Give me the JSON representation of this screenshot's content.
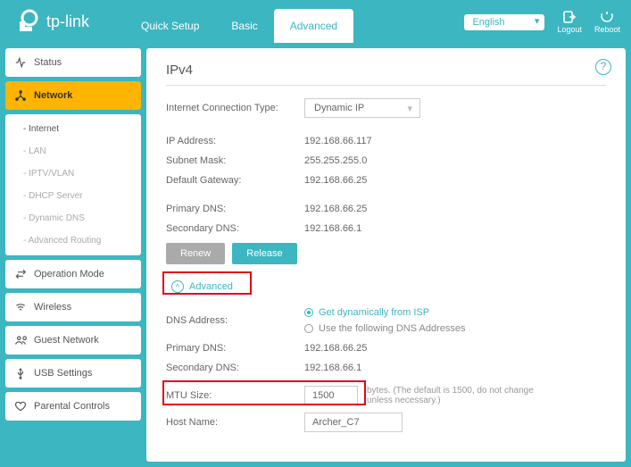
{
  "brand": "tp-link",
  "tabs": {
    "quick": "Quick Setup",
    "basic": "Basic",
    "advanced": "Advanced"
  },
  "language": "English",
  "top_actions": {
    "logout": "Logout",
    "reboot": "Reboot"
  },
  "sidebar": {
    "status": "Status",
    "network": "Network",
    "network_sub": {
      "internet": "Internet",
      "lan": "LAN",
      "iptv": "IPTV/VLAN",
      "dhcp": "DHCP Server",
      "ddns": "Dynamic DNS",
      "routing": "Advanced Routing"
    },
    "opmode": "Operation Mode",
    "wireless": "Wireless",
    "guest": "Guest Network",
    "usb": "USB Settings",
    "parental": "Parental Controls"
  },
  "page": {
    "title": "IPv4",
    "conn_type_label": "Internet Connection Type:",
    "conn_type_value": "Dynamic IP",
    "ip_label": "IP Address:",
    "ip_value": "192.168.66.117",
    "mask_label": "Subnet Mask:",
    "mask_value": "255.255.255.0",
    "gw_label": "Default Gateway:",
    "gw_value": "192.168.66.25",
    "pdns_label": "Primary DNS:",
    "pdns_value": "192.168.66.25",
    "sdns_label": "Secondary DNS:",
    "sdns_value": "192.168.66.1",
    "renew": "Renew",
    "release": "Release",
    "advanced_toggle": "Advanced",
    "dnsaddr_label": "DNS Address:",
    "dns_opt1": "Get dynamically from ISP",
    "dns_opt2": "Use the following DNS Addresses",
    "adv_pdns_label": "Primary DNS:",
    "adv_pdns_value": "192.168.66.25",
    "adv_sdns_label": "Secondary DNS:",
    "adv_sdns_value": "192.168.66.1",
    "mtu_label": "MTU Size:",
    "mtu_value": "1500",
    "mtu_hint": "bytes. (The default is 1500, do not change unless necessary.)",
    "host_label": "Host Name:",
    "host_value": "Archer_C7"
  }
}
